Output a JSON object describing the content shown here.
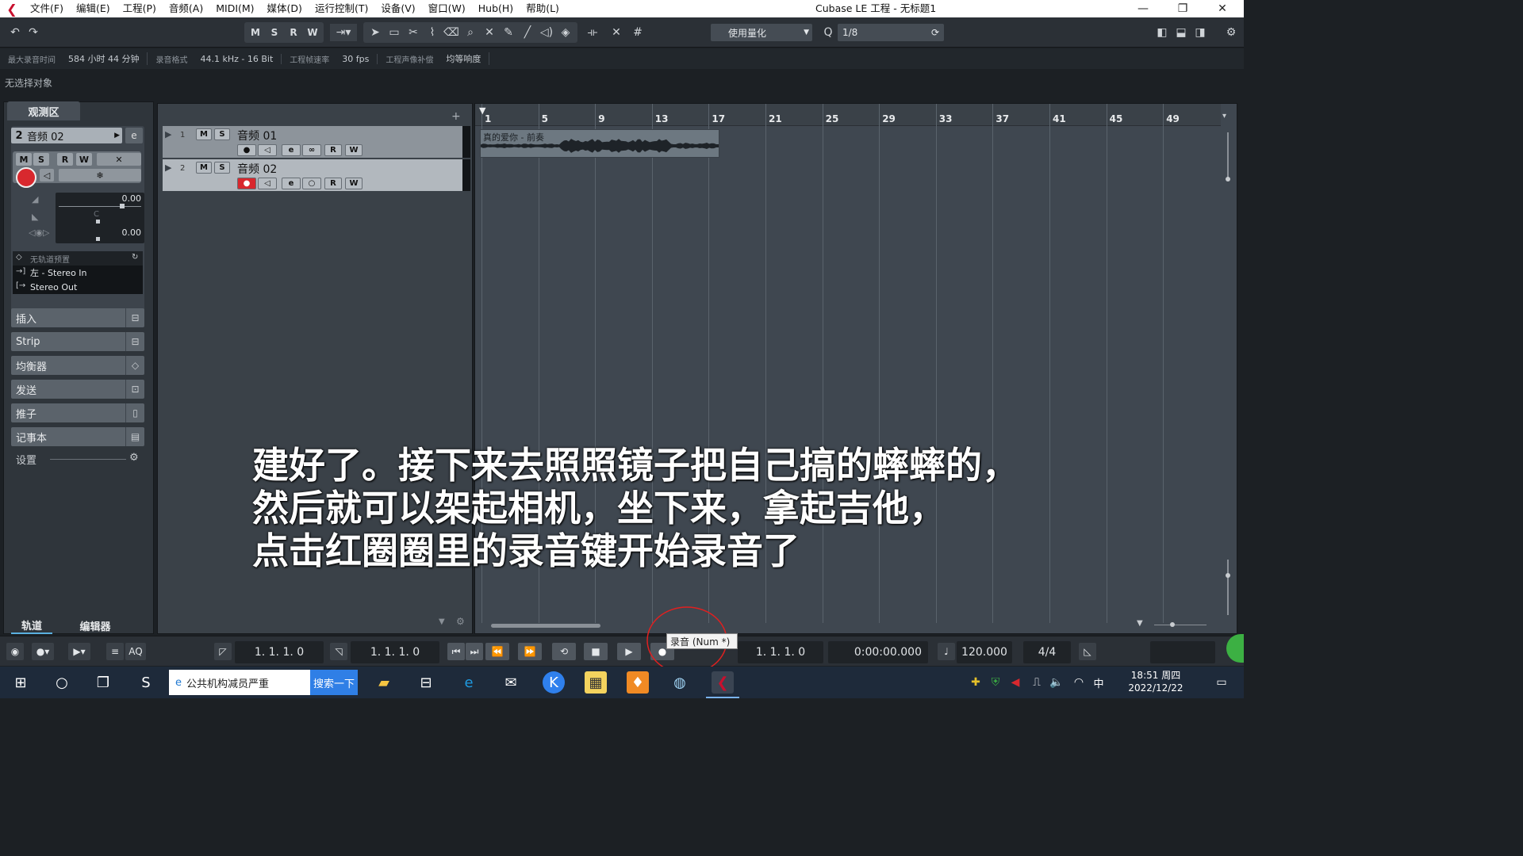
{
  "app": {
    "title": "Cubase LE 工程 - 无标题1",
    "menus": [
      "文件(F)",
      "编辑(E)",
      "工程(P)",
      "音频(A)",
      "MIDI(M)",
      "媒体(D)",
      "运行控制(T)",
      "设备(V)",
      "窗口(W)",
      "Hub(H)",
      "帮助(L)"
    ],
    "window_controls": [
      "—",
      "❐",
      "✕"
    ]
  },
  "toolbar": {
    "msrw": [
      "M",
      "S",
      "R",
      "W"
    ],
    "quantize_label": "使用量化",
    "quantize_value": "1/8",
    "icons": [
      "undo-icon",
      "redo-icon",
      "object-select-icon",
      "range-icon",
      "split-icon",
      "glue-icon",
      "erase-icon",
      "zoom-icon",
      "mute-icon",
      "draw-icon",
      "line-icon",
      "play-icon",
      "color-icon"
    ]
  },
  "info": {
    "rec_time_label": "最大录音时间",
    "rec_time_value": "584 小时 44 分钟",
    "rec_format_label": "录音格式",
    "rec_format_value": "44.1 kHz - 16 Bit",
    "frame_rate_label": "工程帧速率",
    "frame_rate_value": "30 fps",
    "pan_law_label": "工程声像补偿",
    "pan_law_value": "均等响度"
  },
  "selection_status": "无选择对象",
  "inspector": {
    "tab": "观测区",
    "track_number": "2",
    "track_name": "音频 02",
    "btn_m": "M",
    "btn_s": "S",
    "btn_r": "R",
    "btn_w": "W",
    "volume": "0.00",
    "pan": "C",
    "delay": "0.00",
    "preset": "无轨道预置",
    "input": "左 - Stereo In",
    "output": "Stereo Out",
    "sections": [
      "插入",
      "Strip",
      "均衡器",
      "发送",
      "推子",
      "记事本"
    ],
    "settings": "设置",
    "bottom_tabs": [
      "轨道",
      "编辑器"
    ]
  },
  "tracks": [
    {
      "number": "1",
      "name": "音频 01",
      "m": "M",
      "s": "S",
      "r": "R",
      "w": "W",
      "record_armed": false
    },
    {
      "number": "2",
      "name": "音频 02",
      "m": "M",
      "s": "S",
      "r": "R",
      "w": "W",
      "record_armed": true
    }
  ],
  "ruler": {
    "bars": [
      "1",
      "5",
      "9",
      "13",
      "17",
      "21",
      "25",
      "29",
      "33",
      "37",
      "41",
      "45",
      "49"
    ]
  },
  "event": {
    "name": "真的爱你 - 前奏"
  },
  "subtitles": [
    "建好了。接下来去照照镜子把自己搞的蟀蟀的，",
    "然后就可以架起相机，坐下来，拿起吉他，",
    "点击红圈圈里的录音键开始录音了"
  ],
  "transport": {
    "left_locator": "1. 1. 1.    0",
    "right_locator": "1. 1. 1.    0",
    "position_bars": "1. 1. 1.    0",
    "position_time": "0:00:00.000",
    "tempo": "120.000",
    "signature": "4/4",
    "aq_label": "AQ",
    "tooltip": "录音 (Num *)"
  },
  "taskbar": {
    "search_text": "公共机构减员严重",
    "search_button": "搜索一下",
    "time": "18:51 周四",
    "date": "2022/12/22",
    "ime": "中"
  },
  "colors": {
    "accent_red": "#d8282e",
    "annotation_red": "#e02020"
  }
}
